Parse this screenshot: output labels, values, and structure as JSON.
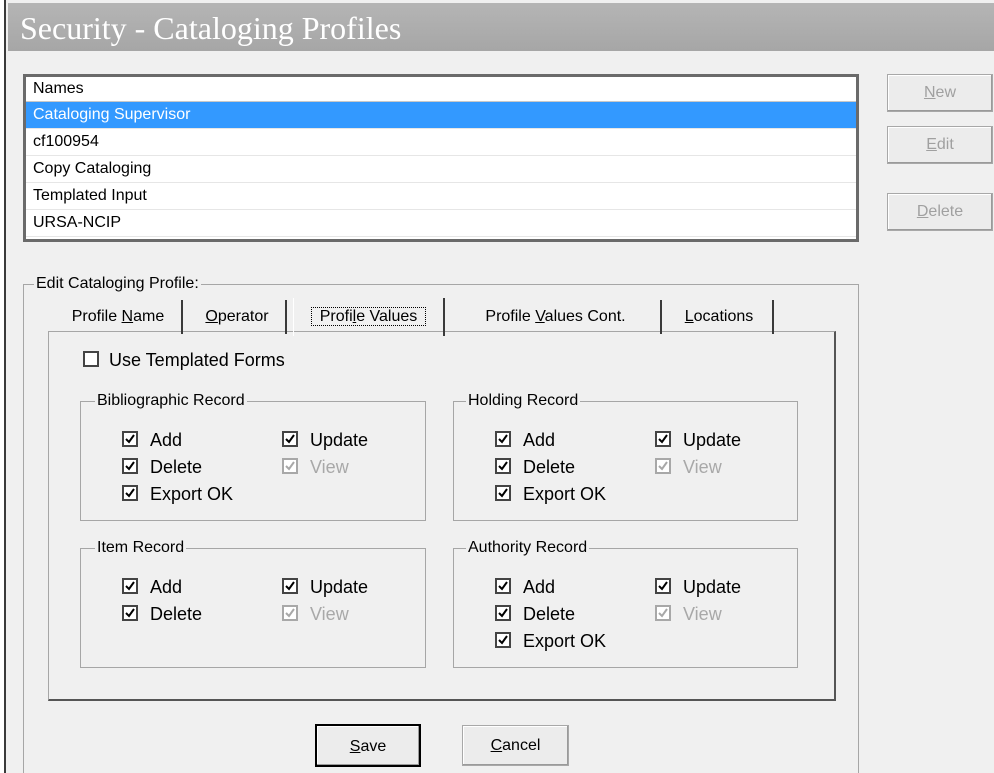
{
  "window": {
    "title": "Security - Cataloging Profiles"
  },
  "names_list": {
    "header": "Names",
    "items": [
      "Cataloging Supervisor",
      "cf100954",
      "Copy Cataloging",
      "Templated Input",
      "URSA-NCIP"
    ],
    "selected_index": 0
  },
  "side_buttons": {
    "new": {
      "pre": "",
      "key": "N",
      "post": "ew"
    },
    "edit": {
      "pre": "",
      "key": "E",
      "post": "dit"
    },
    "delete": {
      "pre": "",
      "key": "D",
      "post": "elete"
    }
  },
  "edit_group": {
    "legend": "Edit Cataloging Profile:"
  },
  "tabs": [
    {
      "pre": "Profile ",
      "key": "N",
      "post": "ame"
    },
    {
      "pre": "",
      "key": "O",
      "post": "perator"
    },
    {
      "pre": "Profi",
      "key": "l",
      "post": "e Values"
    },
    {
      "pre": "Profile ",
      "key": "V",
      "post": "alues Cont."
    },
    {
      "pre": "",
      "key": "L",
      "post": "ocations"
    }
  ],
  "active_tab": "Profile Values",
  "use_templated_forms": {
    "label": "Use Templated Forms",
    "checked": false
  },
  "groups": {
    "bibliographic": {
      "title": "Bibliographic Record",
      "add": "Add",
      "delete": "Delete",
      "export": "Export OK",
      "update": "Update",
      "view": "View"
    },
    "holding": {
      "title": "Holding Record",
      "add": "Add",
      "delete": "Delete",
      "export": "Export OK",
      "update": "Update",
      "view": "View"
    },
    "item": {
      "title": "Item Record",
      "add": "Add",
      "delete": "Delete",
      "update": "Update",
      "view": "View"
    },
    "authority": {
      "title": "Authority Record",
      "add": "Add",
      "delete": "Delete",
      "export": "Export OK",
      "update": "Update",
      "view": "View"
    }
  },
  "footer": {
    "save": {
      "pre": "",
      "key": "S",
      "post": "ave"
    },
    "cancel": {
      "pre": "",
      "key": "C",
      "post": "ancel"
    }
  },
  "colors": {
    "selection": "#3399ff",
    "titlebar": "#a6a6a6",
    "disabled_text": "#a0a0a0"
  }
}
